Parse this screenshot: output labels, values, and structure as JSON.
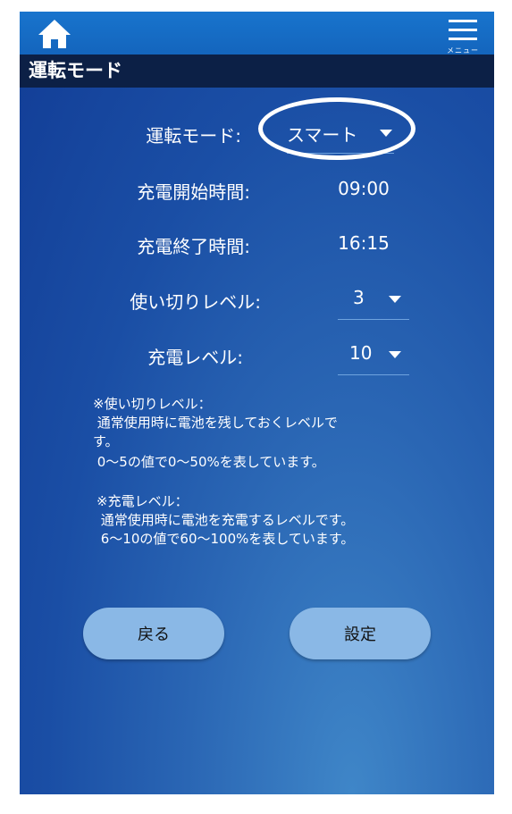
{
  "header": {
    "home_icon": "home-icon",
    "menu_icon": "hamburger-menu-icon",
    "menu_label": "メニュー",
    "page_title": "運転モード"
  },
  "form": {
    "mode_label": "運転モード:",
    "mode_value": "スマート",
    "charge_start_label": "充電開始時間:",
    "charge_start_value": "09:00",
    "charge_end_label": "充電終了時間:",
    "charge_end_value": "16:15",
    "depletion_label": "使い切りレベル:",
    "depletion_value": "3",
    "charge_level_label": "充電レベル:",
    "charge_level_value": "10"
  },
  "notes": {
    "depletion_title": "※使い切りレベル：",
    "depletion_line1": " 通常使用時に電池を残しておくレベルで",
    "depletion_line2": "す。",
    "depletion_line3": " 0～5の値で0～50%を表しています。",
    "charge_title": "※充電レベル：",
    "charge_line1": " 通常使用時に電池を充電するレベルです。",
    "charge_line2": " 6～10の値で60～100%を表しています。"
  },
  "buttons": {
    "back_label": "戻る",
    "set_label": "設定"
  },
  "colors": {
    "topbar": "#1670c8",
    "titlebar": "#0c2046",
    "button": "#8ab8e6"
  }
}
